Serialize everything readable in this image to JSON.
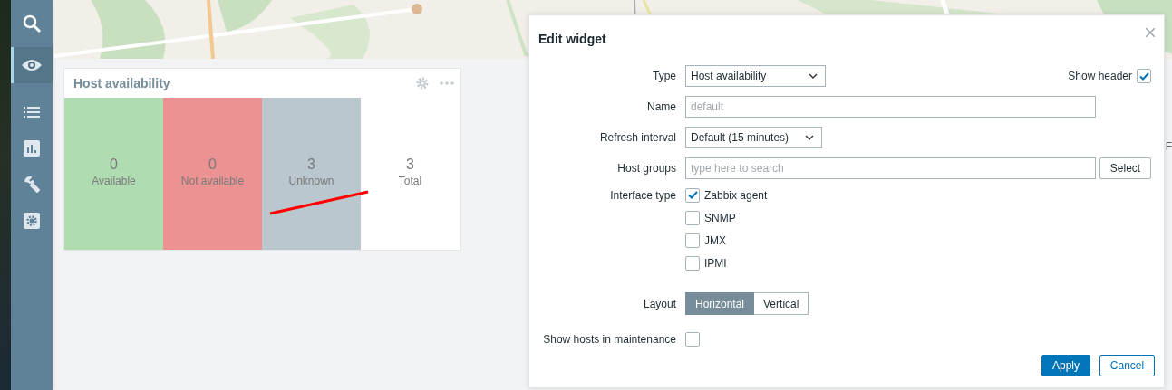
{
  "sidebar": {
    "items": [
      {
        "kind": "search",
        "selected": false
      },
      {
        "kind": "monitoring",
        "selected": true
      },
      {
        "kind": "list",
        "selected": false
      },
      {
        "kind": "reports",
        "selected": false
      },
      {
        "kind": "configuration",
        "selected": false
      },
      {
        "kind": "administration",
        "selected": false
      }
    ]
  },
  "widget": {
    "title": "Host availability",
    "tiles": [
      {
        "count": "0",
        "label": "Available",
        "color": "#b0dcb2"
      },
      {
        "count": "0",
        "label": "Not available",
        "color": "#ec9292"
      },
      {
        "count": "3",
        "label": "Unknown",
        "color": "#bac7ce"
      },
      {
        "count": "3",
        "label": "Total",
        "color": "#ffffff"
      }
    ]
  },
  "background_fragments": [
    {
      "text": "F"
    }
  ],
  "dialog": {
    "title": "Edit widget",
    "type": {
      "label": "Type",
      "value": "Host availability"
    },
    "show_header": {
      "label": "Show header",
      "checked": true
    },
    "name": {
      "label": "Name",
      "placeholder": "default"
    },
    "refresh": {
      "label": "Refresh interval",
      "value": "Default (15 minutes)"
    },
    "host_groups": {
      "label": "Host groups",
      "placeholder": "type here to search",
      "button": "Select"
    },
    "interface_type": {
      "label": "Interface type",
      "options": [
        {
          "label": "Zabbix agent",
          "checked": true
        },
        {
          "label": "SNMP",
          "checked": false
        },
        {
          "label": "JMX",
          "checked": false
        },
        {
          "label": "IPMI",
          "checked": false
        }
      ]
    },
    "layout": {
      "label": "Layout",
      "options": [
        {
          "label": "Horizontal",
          "selected": true
        },
        {
          "label": "Vertical",
          "selected": false
        }
      ]
    },
    "maintenance": {
      "label": "Show hosts in maintenance",
      "checked": false
    },
    "buttons": [
      {
        "label": "Apply",
        "kind": "primary"
      },
      {
        "label": "Cancel",
        "kind": "secondary"
      }
    ]
  }
}
